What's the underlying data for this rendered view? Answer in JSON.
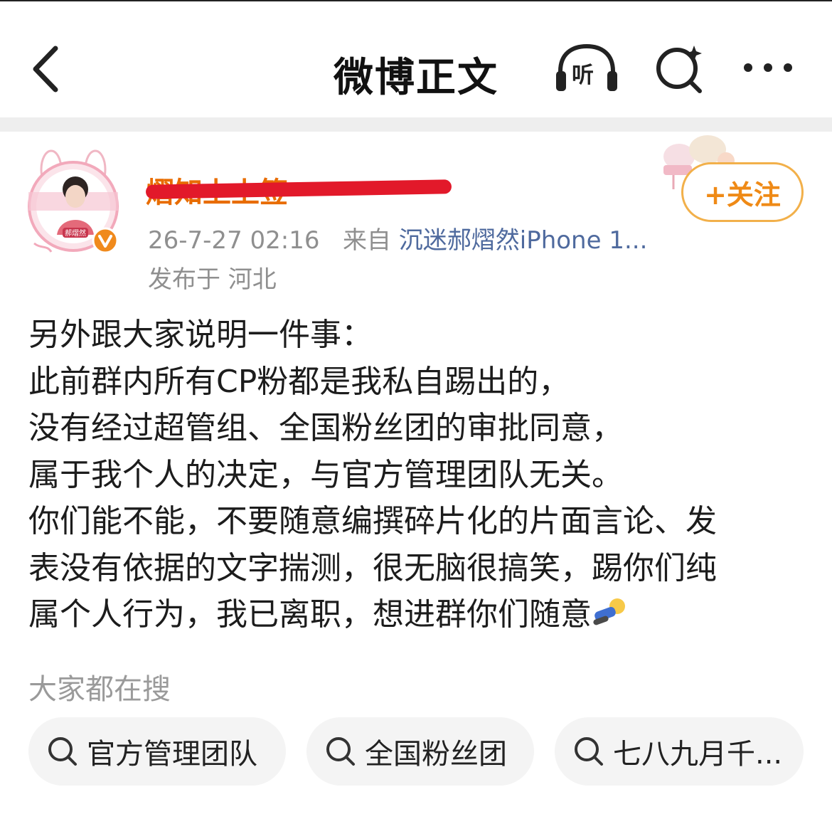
{
  "nav": {
    "title": "微博正文",
    "listen_label": "听"
  },
  "post": {
    "username": "熠知上上签",
    "timestamp": "26-7-27 02:16",
    "source_prefix": "来自",
    "source": "沉迷郝熠然iPhone 1...",
    "location": "发布于 河北",
    "follow_label": "+关注",
    "avatar_caption": "郝熠然",
    "lines": [
      "另外跟大家说明一件事：",
      "此前群内所有CP粉都是我私自踢出的，",
      "没有经过超管组、全国粉丝团的审批同意，",
      "属于我个人的决定，与官方管理团队无关。",
      "你们能不能，不要随意编撰碎片化的片面言论、发",
      "表没有依据的文字揣测，很无脑很搞笑，踢你们纯",
      "属个人行为，我已离职，想进群你们随意"
    ]
  },
  "hot_search": {
    "label": "大家都在搜",
    "chips": [
      "官方管理团队",
      "全国粉丝团",
      "七八九月千..."
    ]
  },
  "colors": {
    "follow": "#ef8a16",
    "source_link": "#4f6a9e",
    "redaction": "#e2192a",
    "verified_badge": "#f08a1c"
  },
  "icons": [
    "back-icon",
    "headphone-icon",
    "search-sparkle-icon",
    "more-icon",
    "search-icon",
    "verified-badge-icon"
  ]
}
